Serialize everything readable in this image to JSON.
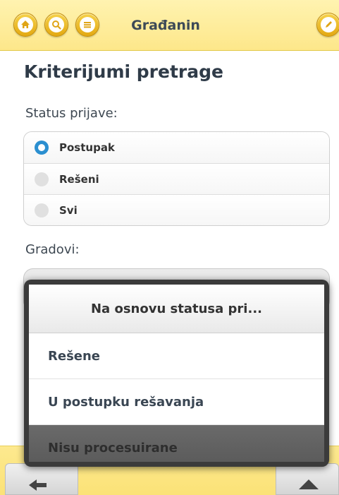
{
  "header": {
    "title": "Građanin",
    "buttons": [
      {
        "icon": "home-icon"
      },
      {
        "icon": "search-icon"
      },
      {
        "icon": "menu-icon"
      },
      {
        "icon": "edit-icon"
      }
    ]
  },
  "page": {
    "title": "Kriterijumi pretrage",
    "status_label": "Status prijave:",
    "cities_label": "Gradovi:"
  },
  "status_options": [
    {
      "label": "Postupak",
      "selected": true
    },
    {
      "label": "Rešeni",
      "selected": false
    },
    {
      "label": "Svi",
      "selected": false
    }
  ],
  "popup": {
    "title": "Na osnovu statusa pri...",
    "items": [
      {
        "label": "Rešene"
      },
      {
        "label": "U postupku rešavanja"
      },
      {
        "label": "Nisu procesuirane",
        "active": true
      }
    ]
  },
  "footer": {
    "back_icon": "arrow-left-icon",
    "up_icon": "triangle-up-icon"
  },
  "colors": {
    "header_bg": "#fde78a",
    "accent": "#e3a913",
    "radio_selected": "#2b8fd0"
  }
}
